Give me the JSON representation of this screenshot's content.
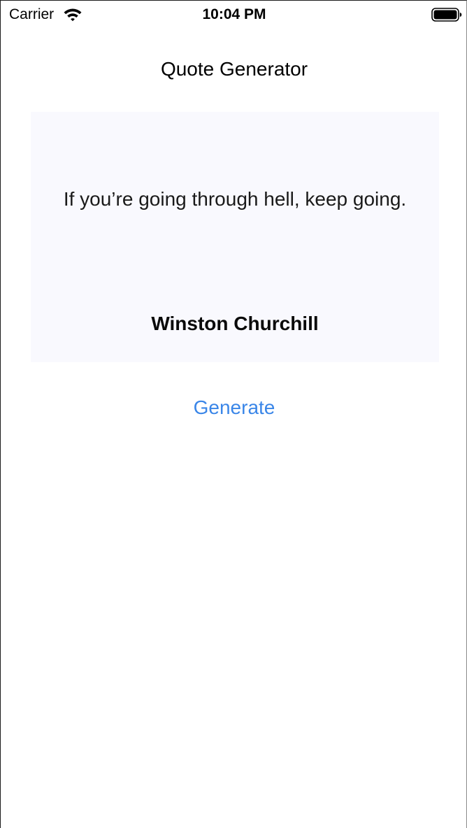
{
  "status_bar": {
    "carrier": "Carrier",
    "time": "10:04 PM",
    "wifi_icon": "wifi-icon",
    "battery_icon": "battery-full-icon"
  },
  "header": {
    "title": "Quote Generator"
  },
  "quote": {
    "text": "If you’re going through hell, keep going.",
    "author": "Winston Churchill"
  },
  "actions": {
    "generate_label": "Generate"
  },
  "colors": {
    "accent": "#3a86e8",
    "card_background": "#f9f9fe",
    "background": "#ffffff"
  }
}
